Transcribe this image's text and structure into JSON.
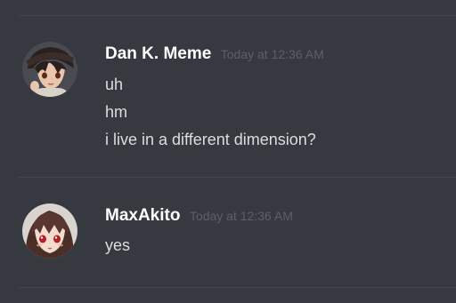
{
  "messages": [
    {
      "username": "Dan K. Meme",
      "timestamp": "Today at 12:36 AM",
      "avatar_icon": "anime-boy-with-cap-avatar",
      "lines": [
        "uh",
        "hm",
        "i live in a different dimension?"
      ]
    },
    {
      "username": "MaxAkito",
      "timestamp": "Today at 12:36 AM",
      "avatar_icon": "anime-girl-avatar",
      "lines": [
        "yes"
      ]
    }
  ],
  "colors": {
    "background": "#36393f",
    "divider": "#42454a",
    "username": "#ffffff",
    "timestamp": "#5c6067",
    "message_text": "#dcddde"
  }
}
